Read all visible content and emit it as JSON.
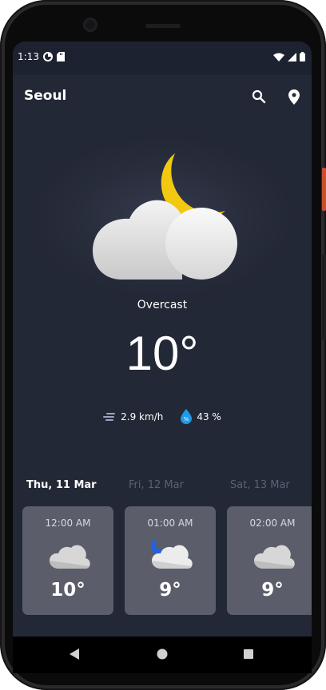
{
  "status_bar": {
    "time": "1:13",
    "left_icons": [
      "data-saver-icon",
      "sd-card-icon"
    ],
    "right_icons": [
      "wifi-icon",
      "cell-signal-icon",
      "battery-icon"
    ]
  },
  "app_bar": {
    "city": "Seoul",
    "actions": [
      "search-icon",
      "location-pin-icon"
    ]
  },
  "current": {
    "icon": "moon-cloud-icon",
    "condition": "Overcast",
    "temperature": "10°",
    "wind_speed": "2.9 km/h",
    "humidity": "43 %"
  },
  "days": [
    {
      "label": "Thu, 11 Mar",
      "selected": true
    },
    {
      "label": "Fri, 12 Mar",
      "selected": false
    },
    {
      "label": "Sat, 13 Mar",
      "selected": false
    }
  ],
  "hourly": [
    {
      "time": "12:00 AM",
      "temp": "10°",
      "icon": "cloud-icon"
    },
    {
      "time": "01:00 AM",
      "temp": "9°",
      "icon": "moon-cloud-icon"
    },
    {
      "time": "02:00 AM",
      "temp": "9°",
      "icon": "cloud-icon"
    }
  ],
  "nav_bar": {
    "buttons": [
      "back-icon",
      "home-icon",
      "recents-icon"
    ]
  },
  "colors": {
    "background": "#232836",
    "card": "#5b5e6a",
    "moon": "#f2c811",
    "humidity_drop": "#1e9be9"
  }
}
